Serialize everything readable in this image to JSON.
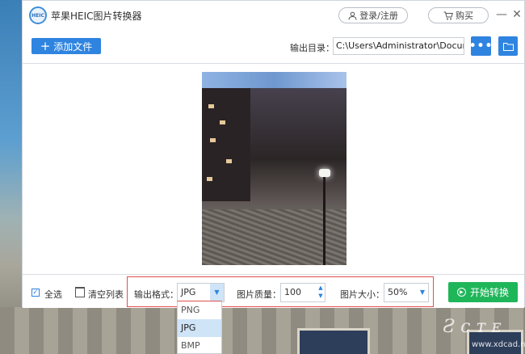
{
  "app": {
    "title": "苹果HEIC图片转换器",
    "logo_text": "HEIC"
  },
  "header": {
    "login_label": "登录/注册",
    "buy_label": "购买",
    "minimize": "—",
    "close": "✕"
  },
  "toolbar": {
    "add_label": "添加文件",
    "output_label": "输出目录：",
    "output_path": "C:\\Users\\Administrator\\Documents",
    "browse_label": "•••"
  },
  "bottom": {
    "select_all_label": "全选",
    "select_all_checked": true,
    "clear_label": "清空列表",
    "format_label": "输出格式：",
    "format_value": "JPG",
    "quality_label": "图片质量：",
    "quality_value": "100",
    "size_label": "图片大小：",
    "size_value": "50%",
    "start_label": "开始转换"
  },
  "format_dropdown": {
    "options": [
      "PNG",
      "JPG",
      "BMP"
    ],
    "selected": "JPG"
  },
  "colors": {
    "accent": "#2f84e0",
    "start": "#1fb65a",
    "highlight_border": "#e0504f"
  },
  "watermark": {
    "text": "Ƨ ᴄ ᴛ ᴇ",
    "url": "www.xdcad.net"
  }
}
